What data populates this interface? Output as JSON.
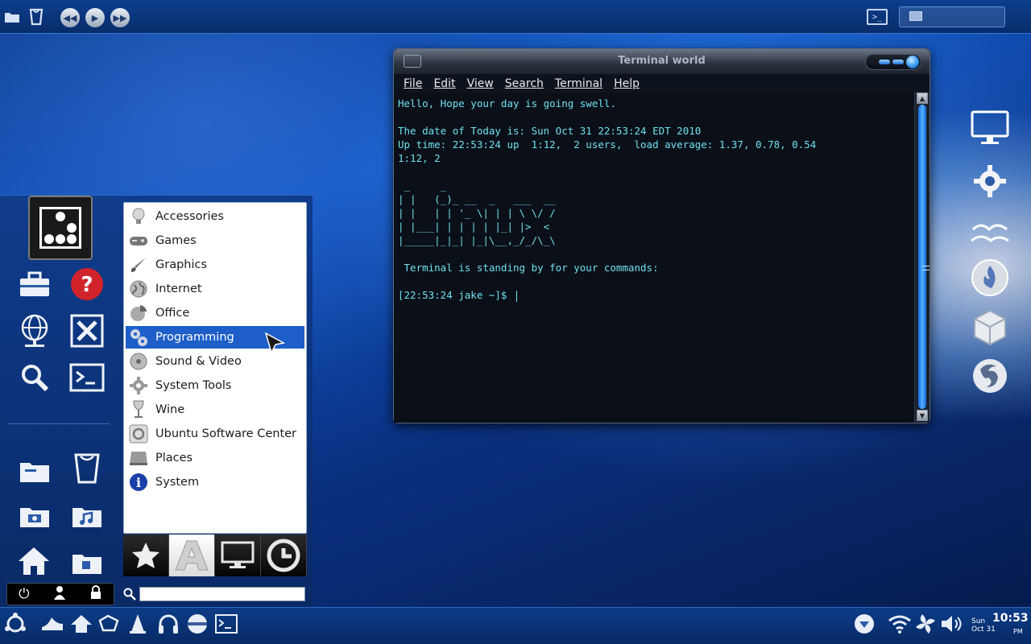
{
  "top_panel": {
    "icons": [
      "folder-icon",
      "trash-icon",
      "previous-icon",
      "play-icon",
      "next-icon",
      "terminal-icon"
    ]
  },
  "terminal": {
    "title": "Terminal world",
    "menus": [
      "File",
      "Edit",
      "View",
      "Search",
      "Terminal",
      "Help"
    ],
    "lines": [
      "Hello, Hope your day is going swell.",
      "",
      "The date of Today is: Sun Oct 31 22:53:24 EDT 2010",
      "Up time: 22:53:24 up  1:12,  2 users,  load average: 1.37, 0.78, 0.54",
      "1:12, 2",
      "",
      " _     _",
      "| |   (_)_ __  _   ___  __",
      "| |   | | '_ \\| | | \\ \\/ /",
      "| |___| | | | | |_| |>  <",
      "|_____|_|_| |_|\\__,_/_/\\_\\",
      "",
      " Terminal is standing by for your commands:",
      "",
      "[22:53:24 jake ~]$ "
    ]
  },
  "menu": {
    "categories": [
      {
        "label": "Accessories",
        "icon": "lightbulb-icon"
      },
      {
        "label": "Games",
        "icon": "gamepad-icon"
      },
      {
        "label": "Graphics",
        "icon": "brush-icon"
      },
      {
        "label": "Internet",
        "icon": "globe-icon"
      },
      {
        "label": "Office",
        "icon": "pie-chart-icon"
      },
      {
        "label": "Programming",
        "icon": "gears-icon",
        "selected": true
      },
      {
        "label": "Sound & Video",
        "icon": "media-icon"
      },
      {
        "label": "System Tools",
        "icon": "gear-icon"
      },
      {
        "label": "Wine",
        "icon": "wine-glass-icon"
      },
      {
        "label": "Ubuntu Software Center",
        "icon": "software-center-icon"
      },
      {
        "label": "Places",
        "icon": "places-icon"
      },
      {
        "label": "System",
        "icon": "info-icon"
      }
    ],
    "tabs": [
      "favorites-icon",
      "applications-icon",
      "computer-icon",
      "recent-icon"
    ],
    "search_value": ""
  },
  "clock": {
    "day": "Sun",
    "date": "Oct 31",
    "time": "10:53",
    "ampm": "PM"
  },
  "colors": {
    "selection": "#1d5ec9",
    "terminal_text": "#6fe0ee",
    "terminal_bg": "#0a0f18"
  }
}
